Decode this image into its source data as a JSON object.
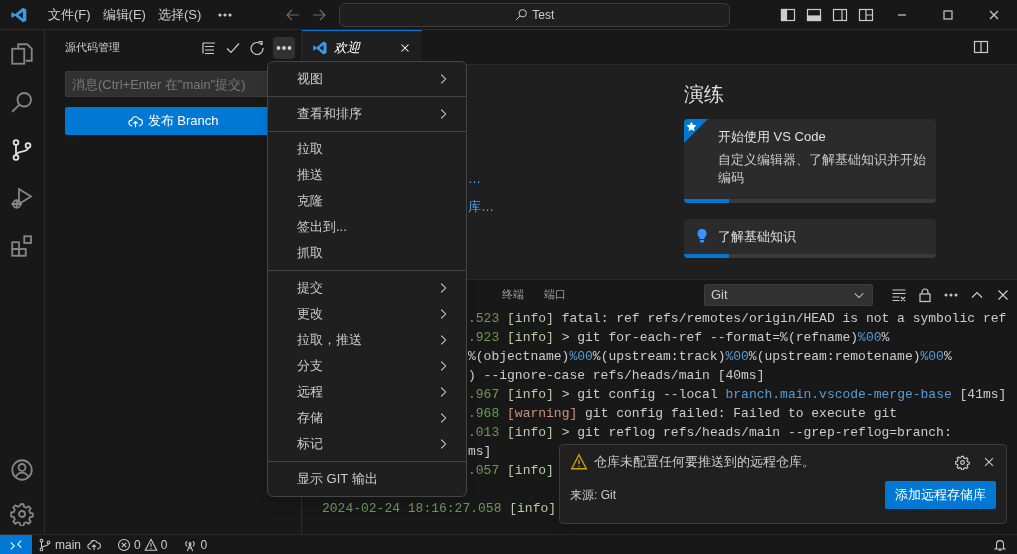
{
  "title_bar": {
    "menus": [
      "文件(F)",
      "编辑(E)",
      "选择(S)"
    ],
    "search": "Test"
  },
  "activity_bar": {
    "items": [
      {
        "kind": "files",
        "selected": false
      },
      {
        "kind": "search",
        "selected": false
      },
      {
        "kind": "source-control",
        "selected": true
      },
      {
        "kind": "run",
        "selected": false
      },
      {
        "kind": "extensions",
        "selected": false
      }
    ]
  },
  "sidebar": {
    "title": "源代码管理",
    "message_placeholder": "消息(Ctrl+Enter 在\"main\"提交)",
    "publish_button": "发布 Branch"
  },
  "editor": {
    "tab": {
      "label": "欢迎",
      "selected": true
    },
    "links": [
      "…",
      "库…"
    ],
    "walkthroughs": {
      "heading": "演练",
      "cards": [
        {
          "title": "开始使用 VS Code",
          "description": "自定义编辑器、了解基础知识并开始编码",
          "featured": true,
          "level": 0.18
        },
        {
          "title": "了解基础知识",
          "featured": false,
          "level": 0.18
        }
      ]
    }
  },
  "panel": {
    "tabs": [
      {
        "label": "终端",
        "selected": false
      },
      {
        "label": "端口",
        "selected": false
      }
    ],
    "output_channel": "Git",
    "log": [
      {
        "kind": "fragment",
        "parts": [
          {
            "kind": "time",
            "text": ".523"
          },
          {
            "kind": "level",
            "text": "[info]"
          },
          {
            "kind": "text",
            "text": "fatal: ref refs/remotes/origin/HEAD is not a symbolic ref"
          }
        ]
      },
      {
        "kind": "fragment",
        "parts": [
          {
            "kind": "time",
            "text": ".923"
          },
          {
            "kind": "level",
            "text": "[info]"
          },
          {
            "kind": "text",
            "text": "> git for-each-ref --format=%(refname)"
          },
          {
            "kind": "code",
            "text": "%00"
          },
          {
            "kind": "text",
            "text": "%"
          }
        ]
      },
      {
        "kind": "fragment",
        "parts": [
          {
            "kind": "text",
            "text": "%(objectname)"
          },
          {
            "kind": "code",
            "text": "%00"
          },
          {
            "kind": "text",
            "text": "%(upstream:track)"
          },
          {
            "kind": "code",
            "text": "%00"
          },
          {
            "kind": "text",
            "text": "%(upstream:remotename)"
          },
          {
            "kind": "code",
            "text": "%00"
          },
          {
            "kind": "text",
            "text": "%"
          }
        ]
      },
      {
        "kind": "fragment",
        "parts": [
          {
            "kind": "text",
            "text": ") --ignore-case refs/heads/main [40ms]"
          }
        ]
      },
      {
        "kind": "fragment",
        "parts": [
          {
            "kind": "time",
            "text": ".967"
          },
          {
            "kind": "level",
            "text": "[info]"
          },
          {
            "kind": "text",
            "text": "> git config --local"
          },
          {
            "kind": "code",
            "text": "branch.main.vscode-merge-base"
          },
          {
            "kind": "text",
            "text": "[41ms]"
          }
        ]
      },
      {
        "kind": "fragment",
        "parts": [
          {
            "kind": "time",
            "text": ".968"
          },
          {
            "kind": "warning",
            "text": "[warning]"
          },
          {
            "kind": "text",
            "text": "git config failed: Failed to execute git"
          }
        ]
      },
      {
        "kind": "fragment",
        "parts": [
          {
            "kind": "time",
            "text": ".013"
          },
          {
            "kind": "level",
            "text": "[info]"
          },
          {
            "kind": "text",
            "text": "> git reflog refs/heads/main --grep-reflog=branch:"
          }
        ]
      },
      {
        "kind": "fragment",
        "parts": [
          {
            "kind": "text",
            "text": "ms]"
          }
        ]
      },
      {
        "kind": "fragment",
        "parts": [
          {
            "kind": "time",
            "text": ".057"
          },
          {
            "kind": "level",
            "text": "[info]"
          }
        ]
      },
      {
        "kind": "blank"
      },
      {
        "kind": "full",
        "parts": [
          {
            "kind": "time",
            "text": "2024-02-24 18:16:27.058"
          },
          {
            "kind": "level",
            "text": "[info]"
          }
        ]
      }
    ]
  },
  "menu": {
    "groups": [
      [
        {
          "label": "视图",
          "submenu": true
        }
      ],
      [
        {
          "label": "查看和排序",
          "submenu": true
        }
      ],
      [
        {
          "label": "拉取",
          "submenu": false
        },
        {
          "label": "推送",
          "submenu": false
        },
        {
          "label": "克隆",
          "submenu": false
        },
        {
          "label": "签出到...",
          "submenu": false
        },
        {
          "label": "抓取",
          "submenu": false
        }
      ],
      [
        {
          "label": "提交",
          "submenu": true
        },
        {
          "label": "更改",
          "submenu": true
        },
        {
          "label": "拉取，推送",
          "submenu": true
        },
        {
          "label": "分支",
          "submenu": true
        },
        {
          "label": "远程",
          "submenu": true
        },
        {
          "label": "存储",
          "submenu": true
        },
        {
          "label": "标记",
          "submenu": true
        }
      ],
      [
        {
          "label": "显示 GIT 输出",
          "submenu": false
        }
      ]
    ]
  },
  "notification": {
    "message": "仓库未配置任何要推送到的远程仓库。",
    "source": "来源: Git",
    "action": "添加远程存储库"
  },
  "status_bar": {
    "branch": "main",
    "errors": "0",
    "warnings": "0",
    "ports": "0"
  }
}
